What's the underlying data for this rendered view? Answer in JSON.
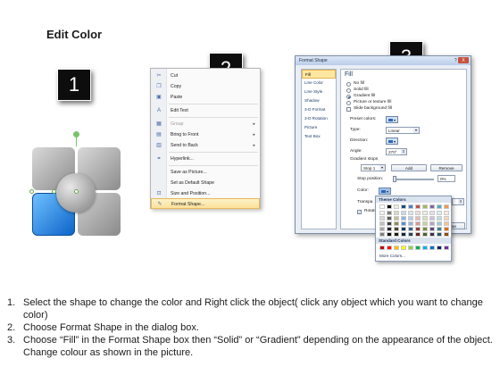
{
  "title": "Edit Color",
  "badges": [
    "1",
    "2",
    "3"
  ],
  "context_menu": {
    "items": [
      {
        "label": "Cut",
        "icon": "scissors-icon",
        "glyph": "✂",
        "disabled": false,
        "submenu": false,
        "highlight": false
      },
      {
        "label": "Copy",
        "icon": "copy-icon",
        "glyph": "❐",
        "disabled": false,
        "submenu": false,
        "highlight": false
      },
      {
        "label": "Paste",
        "icon": "paste-icon",
        "glyph": "📋",
        "disabled": false,
        "submenu": false,
        "highlight": false
      },
      {
        "label": "Edit Text",
        "icon": "edit-text-icon",
        "glyph": "A",
        "disabled": false,
        "submenu": false,
        "highlight": false
      },
      {
        "label": "Group",
        "icon": "group-icon",
        "glyph": "▦",
        "disabled": true,
        "submenu": true,
        "highlight": false
      },
      {
        "label": "Bring to Front",
        "icon": "bring-front-icon",
        "glyph": "▤",
        "disabled": false,
        "submenu": true,
        "highlight": false
      },
      {
        "label": "Send to Back",
        "icon": "send-back-icon",
        "glyph": "▥",
        "disabled": false,
        "submenu": true,
        "highlight": false
      },
      {
        "label": "Hyperlink...",
        "icon": "hyperlink-icon",
        "glyph": "⚭",
        "disabled": false,
        "submenu": false,
        "highlight": false
      },
      {
        "label": "Save as Picture...",
        "icon": "",
        "glyph": "",
        "disabled": false,
        "submenu": false,
        "highlight": false
      },
      {
        "label": "Set as Default Shape",
        "icon": "",
        "glyph": "",
        "disabled": false,
        "submenu": false,
        "highlight": false
      },
      {
        "label": "Size and Position...",
        "icon": "size-position-icon",
        "glyph": "⊡",
        "disabled": false,
        "submenu": false,
        "highlight": false
      },
      {
        "label": "Format Shape...",
        "icon": "format-shape-icon",
        "glyph": "✎",
        "disabled": false,
        "submenu": false,
        "highlight": true
      }
    ]
  },
  "dialog": {
    "title": "Format Shape",
    "close_label": "X",
    "nav": [
      "Fill",
      "Line Color",
      "Line Style",
      "Shadow",
      "3-D Format",
      "3-D Rotation",
      "Picture",
      "Text Box"
    ],
    "panel_title": "Fill",
    "fill_options": [
      {
        "label": "No fill",
        "selected": false
      },
      {
        "label": "Solid fill",
        "selected": false
      },
      {
        "label": "Gradient fill",
        "selected": true
      },
      {
        "label": "Picture or texture fill",
        "selected": false
      }
    ],
    "slide_background_label": "Slide background fill",
    "preset_colors_label": "Preset colors:",
    "type_label": "Type:",
    "type_value": "Linear",
    "direction_label": "Direction:",
    "angle_label": "Angle:",
    "angle_value": "270°",
    "gradient_stops_label": "Gradient stops",
    "stop_value": "Stop 1",
    "add_label": "Add",
    "remove_label": "Remove",
    "stop_position_label": "Stop position:",
    "stop_position_value": "0%",
    "color_label": "Color:",
    "transparency_label": "Transpa",
    "rotate_label": "Rotate",
    "close_button": "Close"
  },
  "picker": {
    "theme_label": "Theme Colors",
    "standard_label": "Standard Colors",
    "more_label": "More Colors...",
    "theme_top": [
      "#ffffff",
      "#000000",
      "#eeece1",
      "#1f497d",
      "#4f81bd",
      "#c0504d",
      "#9bbb59",
      "#8064a2",
      "#4bacc6",
      "#f79646"
    ],
    "theme_rows": [
      [
        "#f2f2f2",
        "#7f7f7f",
        "#ddd9c3",
        "#c6d9f0",
        "#dbe5f1",
        "#f2dcdb",
        "#ebf1dd",
        "#e5e0ec",
        "#dbeef3",
        "#fdeada"
      ],
      [
        "#d8d8d8",
        "#595959",
        "#c4bd97",
        "#8db3e2",
        "#b8cce4",
        "#e5b9b7",
        "#d7e3bc",
        "#ccc1d9",
        "#b7dde8",
        "#fbd5b5"
      ],
      [
        "#bfbfbf",
        "#3f3f3f",
        "#938953",
        "#548dd4",
        "#95b3d7",
        "#d99694",
        "#c3d69b",
        "#b2a2c7",
        "#92cddc",
        "#fac08f"
      ],
      [
        "#a5a5a5",
        "#262626",
        "#494429",
        "#17365d",
        "#366092",
        "#953734",
        "#76923c",
        "#5f497a",
        "#31859b",
        "#e36c09"
      ],
      [
        "#7f7f7f",
        "#0c0c0c",
        "#1d1b10",
        "#0f243e",
        "#244061",
        "#632423",
        "#4f6128",
        "#3f3151",
        "#205867",
        "#974806"
      ]
    ],
    "standard": [
      "#c00000",
      "#ff0000",
      "#ffc000",
      "#ffff00",
      "#92d050",
      "#00b050",
      "#00b0f0",
      "#0070c0",
      "#002060",
      "#7030a0"
    ]
  },
  "instructions": [
    {
      "num": "1.",
      "text": "Select the shape to change the color and Right click the object( click any object which you want to change color)"
    },
    {
      "num": "2.",
      "text": "Choose Format Shape in the dialog box."
    },
    {
      "num": "3.",
      "text": "Choose “Fill” in the Format Shape box then “Solid” or “Gradient” depending on the appearance of the object. Change colour as shown in the picture."
    }
  ]
}
